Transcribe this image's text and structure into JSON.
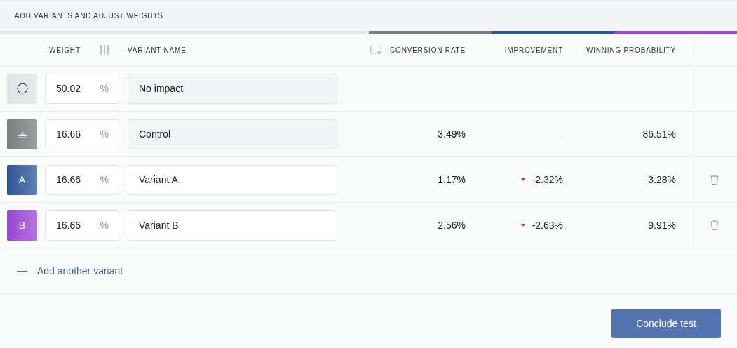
{
  "section_title": "ADD VARIANTS AND ADJUST WEIGHTS",
  "columns": {
    "weight": "WEIGHT",
    "variant_name": "VARIANT NAME",
    "conversion_rate": "CONVERSION RATE",
    "improvement": "IMPROVEMENT",
    "winning_probability": "WINNING PROBABILITY"
  },
  "variants": [
    {
      "kind": "no_impact",
      "color": "#e2e3e5",
      "weight": "50.02",
      "unit": "%",
      "name": "No impact",
      "disabled": true,
      "deletable": false
    },
    {
      "kind": "control",
      "color": "#7b7c80",
      "weight": "16.66",
      "unit": "%",
      "name": "Control",
      "disabled": true,
      "deletable": false,
      "conversion_rate": "3.49%",
      "improvement": "—",
      "negative": false,
      "winning_probability": "86.51%"
    },
    {
      "kind": "letter",
      "letter": "A",
      "color": "#2d5597",
      "weight": "16.66",
      "unit": "%",
      "name": "Variant A",
      "disabled": false,
      "deletable": true,
      "conversion_rate": "1.17%",
      "improvement": "-2.32%",
      "negative": true,
      "winning_probability": "3.28%"
    },
    {
      "kind": "letter",
      "letter": "B",
      "color": "#9a45d4",
      "weight": "16.66",
      "unit": "%",
      "name": "Variant B",
      "disabled": false,
      "deletable": true,
      "conversion_rate": "2.56%",
      "improvement": "-2.63%",
      "negative": true,
      "winning_probability": "9.91%"
    }
  ],
  "add_variant": "Add another variant",
  "conclude_button": "Conclude test"
}
